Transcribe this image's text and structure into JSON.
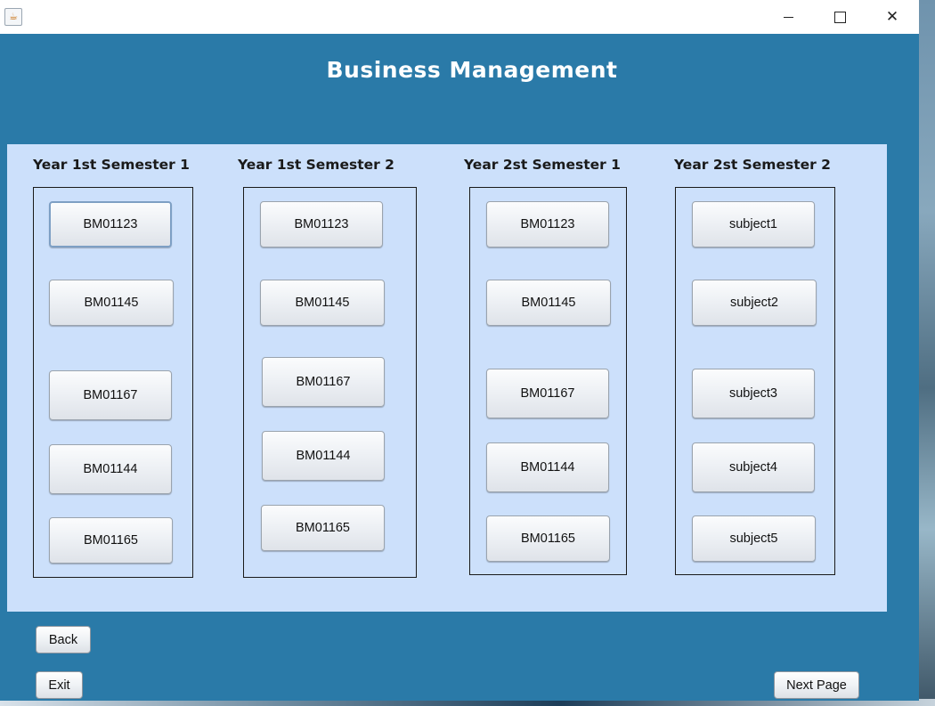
{
  "window": {
    "app_icon_glyph": "☕",
    "controls": {
      "minimize": "minimize-icon",
      "maximize": "maximize-icon",
      "close": "✕"
    }
  },
  "title": "Business Management",
  "semesters": [
    {
      "label": "Year 1st Semester 1",
      "subjects": [
        "BM01123",
        "BM01145",
        "BM01167",
        "BM01144",
        "BM01165"
      ]
    },
    {
      "label": "Year 1st Semester 2",
      "subjects": [
        "BM01123",
        "BM01145",
        "BM01167",
        "BM01144",
        "BM01165"
      ]
    },
    {
      "label": "Year 2st Semester 1",
      "subjects": [
        "BM01123",
        "BM01145",
        "BM01167",
        "BM01144",
        "BM01165"
      ]
    },
    {
      "label": "Year 2st Semester 2",
      "subjects": [
        "subject1",
        "subject2",
        "subject3",
        "subject4",
        "subject5"
      ]
    }
  ],
  "footer": {
    "back_label": "Back",
    "exit_label": "Exit",
    "next_label": "Next Page"
  },
  "colors": {
    "window_bg": "#2a7aa8",
    "panel_bg": "#cce0fb",
    "title_text": "#ffffff"
  }
}
